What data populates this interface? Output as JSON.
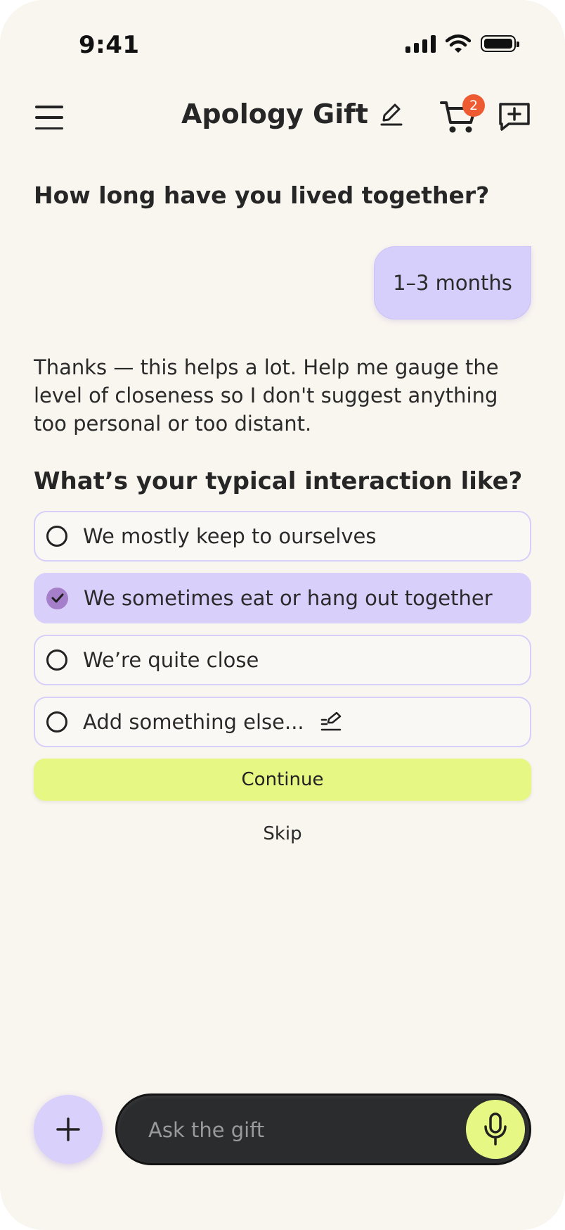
{
  "status_bar": {
    "time": "9:41"
  },
  "header": {
    "title": "Apology Gift",
    "cart_count": "2"
  },
  "conversation": {
    "question_1": "How long have you lived together?",
    "user_answer": "1–3 months",
    "assistant_message": "Thanks — this helps a lot. Help me gauge the level of closeness so I don't suggest anything too personal or too distant.",
    "question_2": "What’s your typical interaction like?",
    "options": [
      {
        "label": "We mostly keep to ourselves",
        "selected": false
      },
      {
        "label": "We sometimes eat or hang out together",
        "selected": true
      },
      {
        "label": "We’re quite close",
        "selected": false
      },
      {
        "label": "Add something else...",
        "selected": false
      }
    ],
    "continue_label": "Continue",
    "skip_label": "Skip"
  },
  "composer": {
    "placeholder": "Ask the gift"
  },
  "icons": {
    "menu": "menu-icon",
    "edit_title": "pencil-icon",
    "cart": "cart-icon",
    "new_chat": "chat-plus-icon",
    "add": "plus-icon",
    "mic": "microphone-icon"
  },
  "colors": {
    "background": "#f9f5ef",
    "accent_lavender": "#d8cffb",
    "accent_lime": "#e7f784",
    "badge": "#ee5a32",
    "composer": "#2b2c2e"
  }
}
